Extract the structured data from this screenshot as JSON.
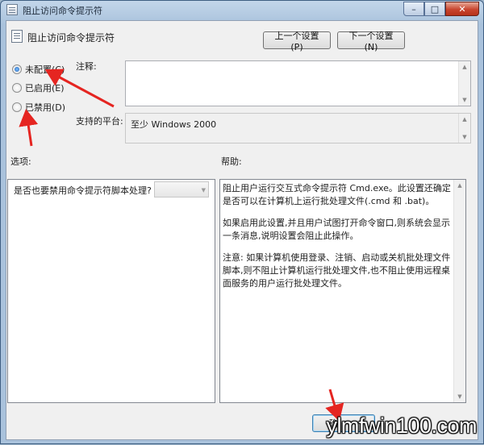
{
  "window": {
    "title": "阻止访问命令提示符",
    "faded_title": "",
    "minimize_glyph": "–",
    "maximize_glyph": "□",
    "close_glyph": "✕"
  },
  "policy": {
    "title": "阻止访问命令提示符"
  },
  "nav": {
    "prev_label": "上一个设置(P)",
    "next_label": "下一个设置(N)"
  },
  "state": {
    "options": [
      {
        "label": "未配置(C)",
        "selected": true
      },
      {
        "label": "已启用(E)",
        "selected": false
      },
      {
        "label": "已禁用(D)",
        "selected": false
      }
    ]
  },
  "comment": {
    "label": "注释:",
    "value": ""
  },
  "platform": {
    "label": "支持的平台:",
    "value": "至少 Windows 2000"
  },
  "options_section": {
    "label": "选项:",
    "question": "是否也要禁用命令提示符脚本处理?",
    "select_value": ""
  },
  "help_section": {
    "label": "帮助:",
    "paragraphs": [
      "阻止用户运行交互式命令提示符 Cmd.exe。此设置还确定是否可以在计算机上运行批处理文件(.cmd 和 .bat)。",
      "如果启用此设置,并且用户试图打开命令窗口,则系统会显示一条消息,说明设置会阻止此操作。",
      "注意: 如果计算机使用登录、注销、启动或关机批处理文件脚本,则不阻止计算机运行批处理文件,也不阻止使用远程桌面服务的用户运行批处理文件。"
    ]
  },
  "footer": {
    "ok_label": "确"
  },
  "watermark": {
    "text": "ylmfwin100.com"
  },
  "colors": {
    "annotation_arrow": "#e52521",
    "selected_radio": "#1b5fb6"
  }
}
